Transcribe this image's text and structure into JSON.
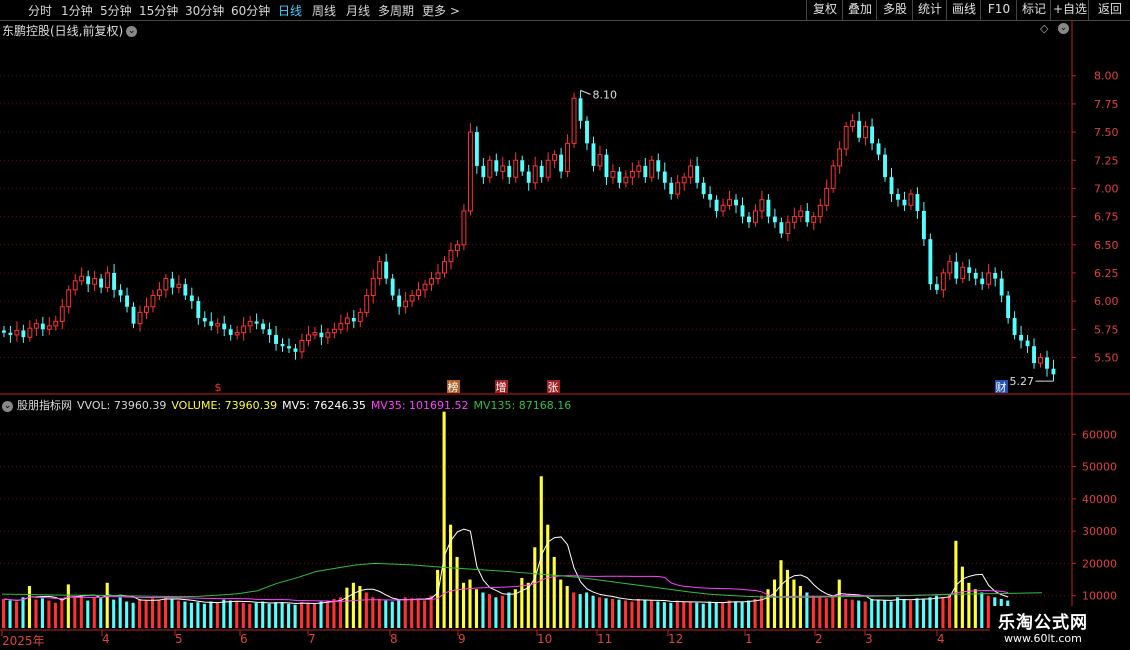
{
  "toolbar": {
    "timeframes": [
      "分时",
      "1分钟",
      "5分钟",
      "15分钟",
      "30分钟",
      "60分钟",
      "日线",
      "周线",
      "月线",
      "多周期",
      "更多 >"
    ],
    "active": "日线",
    "right_buttons": [
      "复权",
      "叠加",
      "多股",
      "统计",
      "画线",
      "F10",
      "标记",
      "+自选",
      "返回"
    ]
  },
  "stock": {
    "title": "东鹏控股(日线,前复权)",
    "menu_icon": "chevron-down-icon"
  },
  "indicator": {
    "name": "股朋指标网",
    "entries": [
      {
        "text": "VVOL: 73960.39",
        "color": "#d8d8d8"
      },
      {
        "text": "VOLUME: 73960.39",
        "color": "#ffff33"
      },
      {
        "text": "MV5: 76246.35",
        "color": "#ffffff"
      },
      {
        "text": "MV35: 101691.52",
        "color": "#ff40ff"
      },
      {
        "text": "MV135: 87168.16",
        "color": "#2fbf3f"
      }
    ]
  },
  "markers": [
    {
      "label": "$",
      "color": "#ff3030",
      "bg": "none"
    },
    {
      "label": "榜",
      "color": "#ffffff",
      "bg": "#b06020"
    },
    {
      "label": "增",
      "color": "#ffffff",
      "bg": "#a02020"
    },
    {
      "label": "张",
      "color": "#ffffff",
      "bg": "#a02020"
    },
    {
      "label": "财",
      "color": "#ffffff",
      "bg": "#2050b0"
    }
  ],
  "dates": [
    "2025年",
    "4",
    "5",
    "6",
    "7",
    "8",
    "9",
    "10",
    "11",
    "12",
    "1",
    "2",
    "3",
    "4"
  ],
  "watermark": {
    "line1": "乐淘公式网",
    "line2": "www.60lt.com"
  },
  "colors": {
    "up": "#ff3333",
    "down": "#54ffff",
    "grid": "#800000",
    "axis": "#c02020"
  },
  "chart_data": [
    {
      "type": "candlestick",
      "title": "东鹏控股(日线,前复权)",
      "ylim": [
        5.3,
        8.2
      ],
      "y_ticks": [
        5.5,
        5.75,
        6.0,
        6.25,
        6.5,
        6.75,
        7.0,
        7.25,
        7.5,
        7.75,
        8.0
      ],
      "high_label": "8.10",
      "low_label": "5.27",
      "close": [
        5.72,
        5.7,
        5.74,
        5.68,
        5.76,
        5.8,
        5.75,
        5.78,
        5.82,
        5.95,
        6.1,
        6.18,
        6.22,
        6.15,
        6.2,
        6.12,
        6.25,
        6.1,
        6.05,
        5.95,
        5.8,
        5.9,
        5.95,
        6.05,
        6.1,
        6.2,
        6.12,
        6.15,
        6.05,
        6.0,
        5.85,
        5.82,
        5.78,
        5.8,
        5.75,
        5.7,
        5.72,
        5.78,
        5.82,
        5.8,
        5.75,
        5.7,
        5.62,
        5.6,
        5.58,
        5.55,
        5.65,
        5.7,
        5.72,
        5.68,
        5.72,
        5.75,
        5.8,
        5.85,
        5.82,
        5.9,
        6.05,
        6.2,
        6.35,
        6.2,
        6.05,
        5.95,
        6.0,
        6.05,
        6.1,
        6.15,
        6.2,
        6.25,
        6.35,
        6.45,
        6.5,
        6.8,
        7.5,
        7.2,
        7.1,
        7.25,
        7.15,
        7.2,
        7.1,
        7.25,
        7.15,
        7.05,
        7.2,
        7.1,
        7.25,
        7.3,
        7.15,
        7.4,
        7.8,
        7.6,
        7.4,
        7.2,
        7.3,
        7.1,
        7.15,
        7.05,
        7.1,
        7.15,
        7.2,
        7.1,
        7.25,
        7.15,
        7.05,
        6.95,
        7.05,
        7.1,
        7.2,
        7.05,
        6.95,
        6.9,
        6.8,
        6.85,
        6.9,
        6.85,
        6.75,
        6.7,
        6.8,
        6.9,
        6.75,
        6.7,
        6.6,
        6.7,
        6.75,
        6.8,
        6.7,
        6.75,
        6.85,
        7.0,
        7.2,
        7.35,
        7.55,
        7.6,
        7.45,
        7.55,
        7.4,
        7.3,
        7.1,
        6.95,
        6.9,
        6.85,
        6.95,
        6.8,
        6.55,
        6.15,
        6.1,
        6.25,
        6.35,
        6.2,
        6.3,
        6.25,
        6.2,
        6.15,
        6.25,
        6.2,
        6.05,
        5.85,
        5.7,
        5.65,
        5.6,
        5.45,
        5.5,
        5.4,
        5.35
      ],
      "volume": [
        9000,
        8500,
        8200,
        9500,
        13000,
        8800,
        9200,
        8500,
        7800,
        9000,
        13500,
        9500,
        10000,
        8500,
        9500,
        9200,
        14000,
        8800,
        9500,
        8200,
        7800,
        9000,
        8500,
        9200,
        8800,
        9500,
        9000,
        8500,
        8200,
        7800,
        8000,
        7500,
        8200,
        7800,
        8800,
        8500,
        8200,
        7800,
        7500,
        7800,
        8200,
        7500,
        8000,
        7800,
        7500,
        7200,
        8000,
        7800,
        7500,
        8200,
        8500,
        9000,
        9500,
        12500,
        14000,
        13000,
        11000,
        9500,
        9000,
        8500,
        8200,
        8800,
        9500,
        9200,
        9000,
        8500,
        10000,
        18000,
        67000,
        32000,
        22000,
        14000,
        15000,
        12000,
        11000,
        10500,
        9500,
        10000,
        11000,
        12000,
        15500,
        14000,
        25000,
        47000,
        32000,
        22000,
        15000,
        13000,
        11000,
        10500,
        11000,
        10000,
        9500,
        9200,
        9000,
        8800,
        8500,
        8200,
        9000,
        8800,
        8500,
        8200,
        8000,
        7800,
        8500,
        8200,
        8000,
        7800,
        7500,
        8200,
        8000,
        7800,
        8500,
        8200,
        8000,
        8500,
        9000,
        10000,
        12000,
        15000,
        21000,
        18000,
        15000,
        13000,
        11000,
        10000,
        9500,
        9200,
        9800,
        15000,
        9000,
        8800,
        8500,
        8200,
        9000,
        8800,
        8500,
        8200,
        9500,
        9000,
        8500,
        9200,
        8800,
        9500,
        10000,
        9500,
        10500,
        27000,
        19000,
        14000,
        12000,
        11000,
        10000,
        9500,
        9000,
        8500
      ],
      "volume_ylim": [
        0,
        70000
      ],
      "volume_ticks": [
        10000,
        20000,
        30000,
        40000,
        50000,
        60000
      ],
      "mv135": [
        10500,
        10400,
        10300,
        10200,
        10200,
        10100,
        10000,
        9900,
        9800,
        9700,
        9800,
        10200,
        10600,
        11500,
        13800,
        15500,
        17500,
        18500,
        19500,
        20000,
        19800,
        19500,
        19000,
        18600,
        18200,
        17800,
        17400,
        16900,
        16400,
        15900,
        15200,
        14400,
        13600,
        12800,
        12000,
        11200,
        10500,
        10100,
        9800,
        9600,
        9500,
        9500,
        9600,
        9700,
        9800,
        9900,
        10000,
        10200,
        10400,
        10500,
        10600,
        10700,
        10800,
        10900
      ]
    }
  ]
}
